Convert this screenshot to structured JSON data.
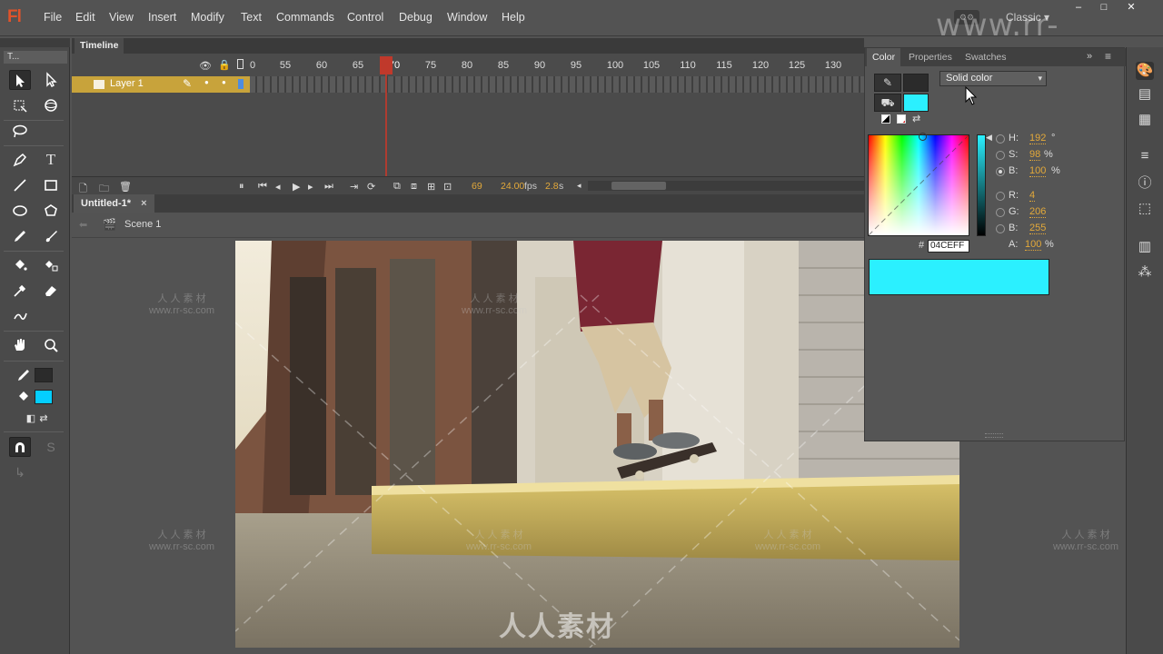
{
  "app": {
    "logo": "Fl",
    "workspace": "Classic",
    "window_controls": [
      "–",
      "□",
      "✕"
    ]
  },
  "menu": [
    "File",
    "Edit",
    "View",
    "Insert",
    "Modify",
    "Text",
    "Commands",
    "Control",
    "Debug",
    "Window",
    "Help"
  ],
  "tools": {
    "panel_title": "T..."
  },
  "timeline": {
    "tab": "Timeline",
    "ruler_ticks": [
      "55",
      "60",
      "65",
      "70",
      "75",
      "80",
      "85",
      "90",
      "95",
      "100",
      "105",
      "110",
      "115",
      "120",
      "125",
      "130"
    ],
    "layer_name": "Layer 1",
    "current_frame": "69",
    "fps": "24.00",
    "fps_unit": "fps",
    "time": "2.8",
    "time_unit": "s"
  },
  "document": {
    "tab": "Untitled-1*",
    "close": "×",
    "scene": "Scene 1"
  },
  "color_panel": {
    "tabs": [
      "Color",
      "Properties",
      "Swatches"
    ],
    "fill_type": "Solid color",
    "stroke_color": "#2b2b2b",
    "fill_color": "#04CEFF",
    "fields": {
      "H": {
        "label": "H:",
        "value": "192",
        "unit": "°"
      },
      "S": {
        "label": "S:",
        "value": "98",
        "unit": "%"
      },
      "B": {
        "label": "B:",
        "value": "100",
        "unit": "%"
      },
      "R": {
        "label": "R:",
        "value": "4"
      },
      "G": {
        "label": "G:",
        "value": "206"
      },
      "Bl": {
        "label": "B:",
        "value": "255"
      },
      "A": {
        "label": "A:",
        "value": "100",
        "unit": "%"
      }
    },
    "hash": "#",
    "hex": "04CEFF"
  },
  "watermark": {
    "site": "www.rr-sc.com",
    "cn": "人人素材",
    "cn_spaced": "人 人 素 材",
    "site_small": "www.rr-sc.com"
  }
}
